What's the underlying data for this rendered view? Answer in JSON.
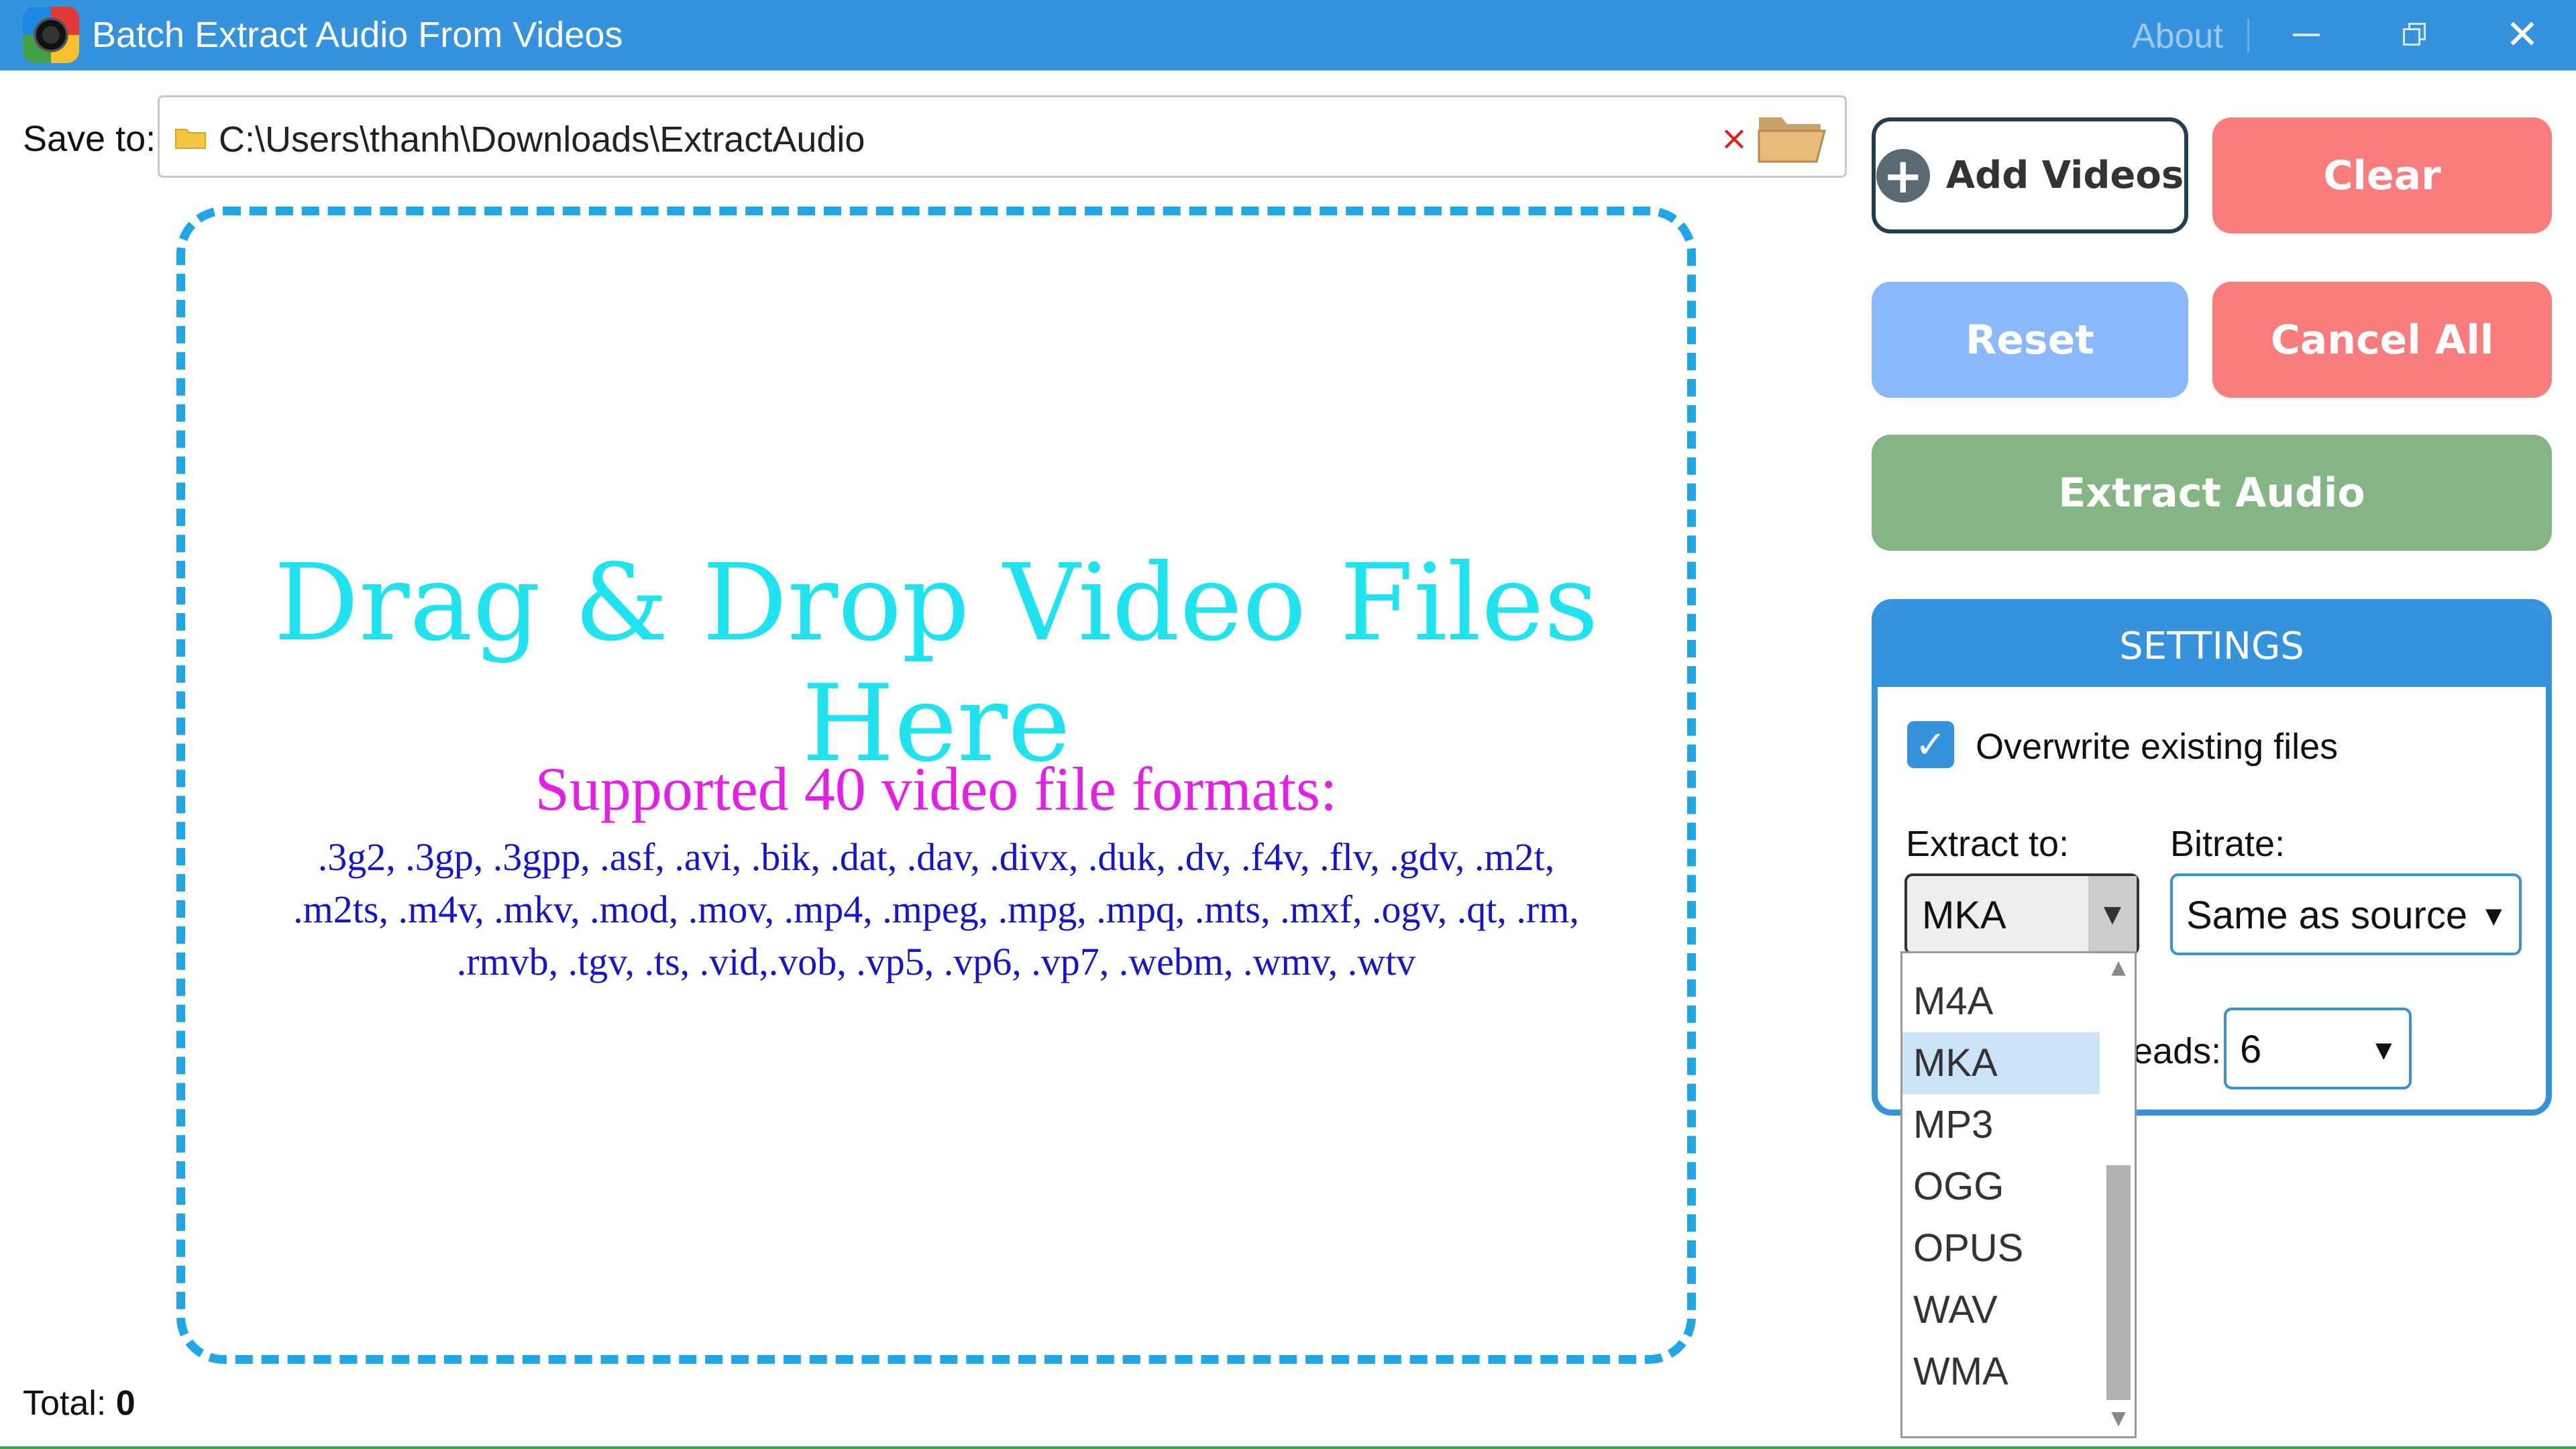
{
  "window": {
    "title": "Batch Extract Audio From Videos",
    "about_label": "About",
    "accent_color": "#3592dc"
  },
  "save_to": {
    "label": "Save to:",
    "path": "C:\\Users\\thanh\\Downloads\\ExtractAudio",
    "clear_icon": "×",
    "browse_icon": "folder-open-icon"
  },
  "drop_zone": {
    "title": "Drag & Drop Video Files Here",
    "formats_heading": "Supported 40 video file formats:",
    "formats_lines": [
      ".3g2, .3gp, .3gpp, .asf, .avi, .bik, .dat, .dav, .divx, .duk, .dv, .f4v, .flv, .gdv, .m2t,",
      ".m2ts, .m4v, .mkv, .mod, .mov, .mp4, .mpeg, .mpg, .mpq, .mts, .mxf, .ogv, .qt, .rm,",
      ".rmvb, .tgv, .ts, .vid,.vob, .vp5, .vp6, .vp7, .webm, .wmv, .wtv"
    ]
  },
  "footer": {
    "total_label": "Total:",
    "total_value": "0"
  },
  "buttons": {
    "add_videos": "Add Videos",
    "clear": "Clear",
    "reset": "Reset",
    "cancel_all": "Cancel All",
    "extract_audio": "Extract Audio"
  },
  "settings": {
    "header": "SETTINGS",
    "overwrite_label": "Overwrite existing files",
    "overwrite_checked": true,
    "extract_to_label": "Extract to:",
    "extract_to_value": "MKA",
    "bitrate_label": "Bitrate:",
    "bitrate_value": "Same as source",
    "threads_label_visible": "eads:",
    "threads_value": "6"
  },
  "format_dropdown": {
    "options": [
      "M4A",
      "MKA",
      "MP3",
      "OGG",
      "OPUS",
      "WAV",
      "WMA"
    ],
    "selected": "MKA"
  }
}
